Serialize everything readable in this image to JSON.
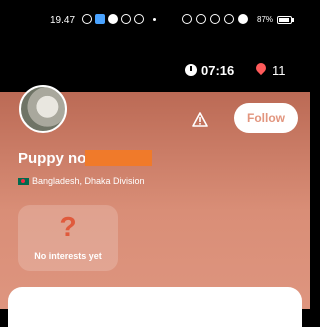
{
  "status_bar": {
    "time": "19.47",
    "battery": "87%"
  },
  "top_bar": {
    "timer": "07:16",
    "pin_count": "11"
  },
  "profile": {
    "name": "Puppy no",
    "location": "Bangladesh, Dhaka Division",
    "follow_label": "Follow",
    "interests_icon": "?",
    "interests_empty": "No interests yet"
  },
  "icons": {
    "timer": "clock-icon",
    "pin": "location-pin-icon",
    "report": "warning-icon",
    "flag": "bangladesh-flag-icon"
  },
  "colors": {
    "header_gradient_top": "#bb6a55",
    "header_gradient_bottom": "#de957f",
    "follow_text": "#e2957e",
    "redaction": "#f07a2a"
  }
}
